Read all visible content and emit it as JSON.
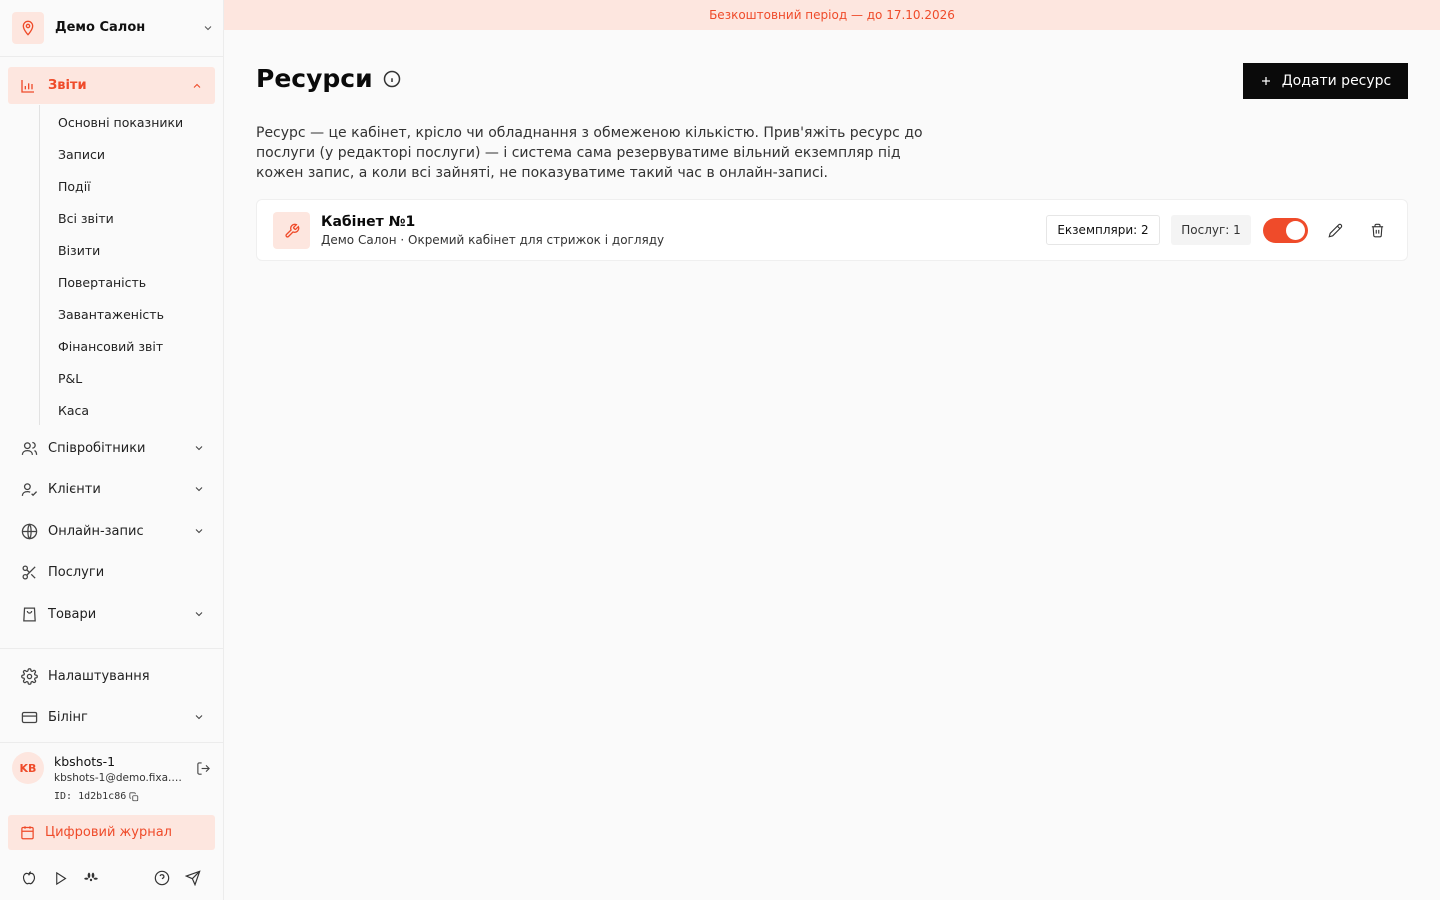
{
  "banner": {
    "text": "Безкоштовний період — до 17.10.2026"
  },
  "sidebar": {
    "salon_name": "Демо Салон",
    "reports": {
      "label": "Звіти",
      "items": [
        "Основні показники",
        "Записи",
        "Події",
        "Всі звіти",
        "Візити",
        "Повертаність",
        "Завантаженість",
        "Фінансовий звіт",
        "P&L",
        "Каса"
      ]
    },
    "nav": [
      {
        "label": "Співробітники",
        "icon": "users-icon",
        "has_chevron": true
      },
      {
        "label": "Клієнти",
        "icon": "user-check-icon",
        "has_chevron": true
      },
      {
        "label": "Онлайн-запис",
        "icon": "globe-icon",
        "has_chevron": true
      },
      {
        "label": "Послуги",
        "icon": "scissors-icon",
        "has_chevron": false
      },
      {
        "label": "Товари",
        "icon": "shopping-bag-icon",
        "has_chevron": true
      }
    ],
    "settings": {
      "label": "Налаштування"
    },
    "billing": {
      "label": "Білінг"
    },
    "user": {
      "initials": "KB",
      "name": "kbshots-1",
      "email": "kbshots-1@demo.fixa.b...",
      "id": "ID: 1d2b1c86"
    },
    "journal": {
      "label": "Цифровий журнал"
    }
  },
  "main": {
    "title": "Ресурси",
    "add_button": "Додати ресурс",
    "description": "Ресурс — це кабінет, крісло чи обладнання з обмеженою кількістю. Прив'яжіть ресурс до послуги (у редакторі послуги) — і система сама резервуватиме вільний екземпляр під кожен запис, а коли всі зайняті, не показуватиме такий час в онлайн-записі.",
    "resources": [
      {
        "name": "Кабінет №1",
        "subtitle": "Демо Салон · Окремий кабінет для стрижок і догляду",
        "instances": "Екземпляри: 2",
        "services": "Послуг: 1",
        "enabled": true
      }
    ]
  },
  "colors": {
    "accent": "#ef4b2a",
    "accent_bg": "#fde6df",
    "dark": "#0a0a0a"
  }
}
